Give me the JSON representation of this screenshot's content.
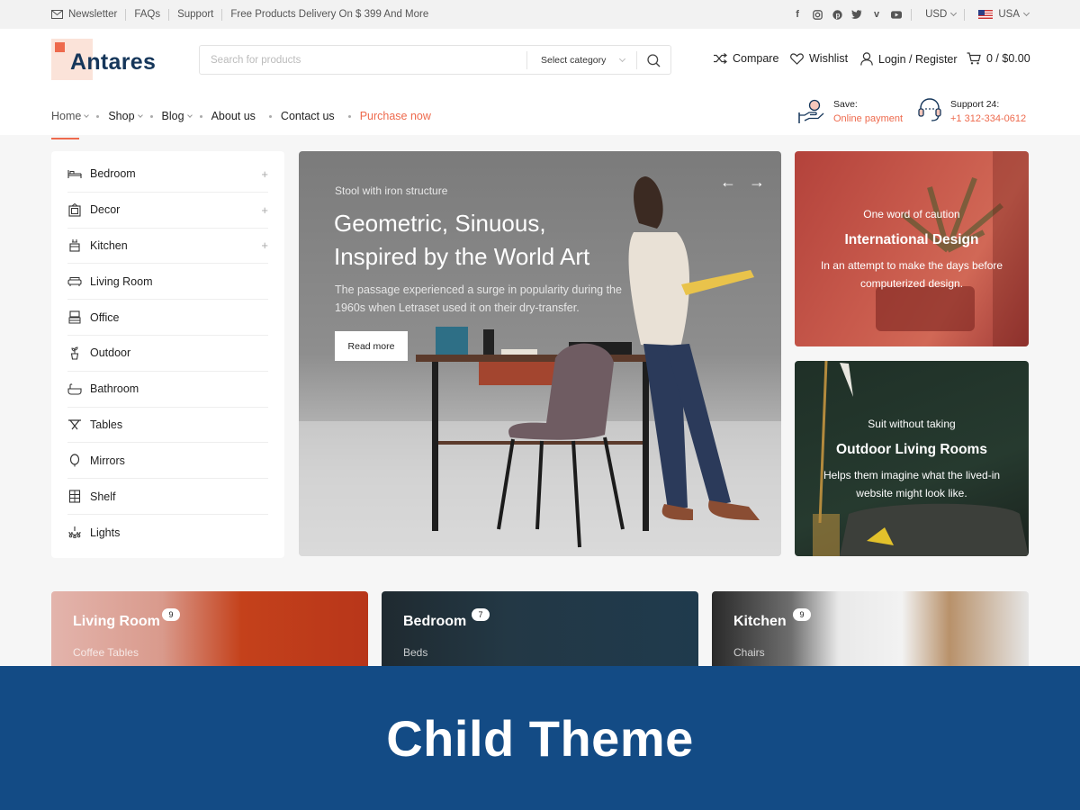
{
  "topbar": {
    "newsletter": "Newsletter",
    "faqs": "FAQs",
    "support": "Support",
    "promo": "Free Products Delivery On $ 399 And More",
    "social_icons": [
      "facebook-icon",
      "instagram-icon",
      "pinterest-icon",
      "twitter-icon",
      "vimeo-icon",
      "youtube-icon"
    ],
    "currency": "USD",
    "country": "USA"
  },
  "header": {
    "logo": "Antares",
    "search_placeholder": "Search for products",
    "category_select": "Select category",
    "compare": "Compare",
    "wishlist": "Wishlist",
    "login": "Login / Register",
    "cart": "0 / $0.00"
  },
  "nav": {
    "items": [
      "Home",
      "Shop",
      "Blog",
      "About us",
      "Contact us",
      "Purchase now"
    ]
  },
  "info": {
    "save_title": "Save:",
    "save_text": "Online payment",
    "support_title": "Support 24:",
    "support_phone": "+1 312-334-0612"
  },
  "sidebar": {
    "items": [
      "Bedroom",
      "Decor",
      "Kitchen",
      "Living Room",
      "Office",
      "Outdoor",
      "Bathroom",
      "Tables",
      "Mirrors",
      "Shelf",
      "Lights"
    ]
  },
  "hero": {
    "subtitle": "Stool with iron structure",
    "title": "Geometric, Sinuous, Inspired by the World Art",
    "description": "The passage experienced a surge in popularity during the 1960s when Letraset used it on their dry-transfer.",
    "button": "Read more"
  },
  "cards": [
    {
      "kicker": "One word of caution",
      "title": "International Design",
      "text": "In an attempt to make the days before computerized design."
    },
    {
      "kicker": "Suit without taking",
      "title": "Outdoor Living Rooms",
      "text": "Helps them imagine what the lived-in website might look like."
    }
  ],
  "categories": [
    {
      "name": "Living Room",
      "count": "9",
      "sub": "Coffee Tables"
    },
    {
      "name": "Bedroom",
      "count": "7",
      "sub": "Beds"
    },
    {
      "name": "Kitchen",
      "count": "9",
      "sub": "Chairs"
    }
  ],
  "banner": "Child Theme",
  "colors": {
    "accent": "#ee6a4d",
    "brand": "#15365a",
    "banner": "#134b85"
  }
}
